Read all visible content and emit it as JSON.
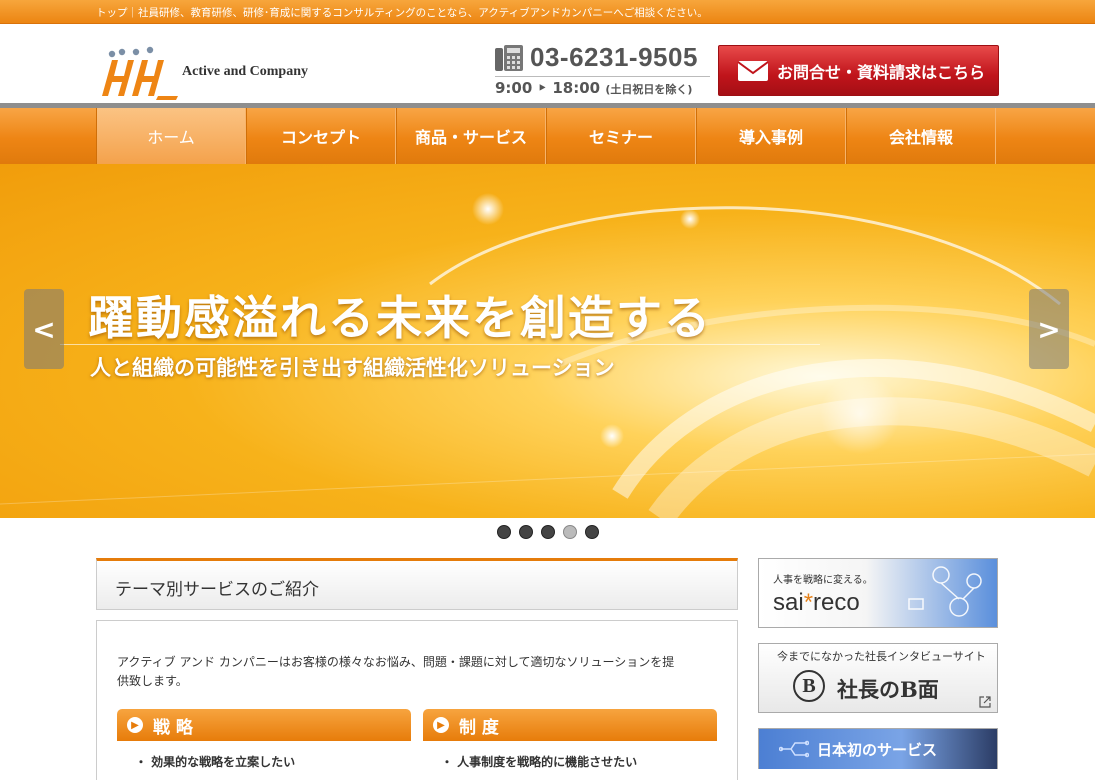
{
  "topbar": {
    "text": "トップ｜社員研修、教育研修、研修･育成に関するコンサルティングのことなら、アクティブアンドカンパニーへご相談ください。"
  },
  "header": {
    "logo_text": "Active and Company",
    "phone": "03-6231-9505",
    "hours": "9:00 ‣ 18:00",
    "hours_note": "(土日祝日を除く)",
    "cta_label": "お問合せ・資料請求はこちら"
  },
  "nav": {
    "items": [
      {
        "label": "ホーム"
      },
      {
        "label": "コンセプト"
      },
      {
        "label": "商品・サービス"
      },
      {
        "label": "セミナー"
      },
      {
        "label": "導入事例"
      },
      {
        "label": "会社情報"
      }
    ]
  },
  "hero": {
    "title": "躍動感溢れる未来を創造する",
    "subtitle": "人と組織の可能性を引き出す組織活性化ソリューション",
    "prev": "<",
    "next": ">",
    "slide_count": 5,
    "active_slide": 4
  },
  "section": {
    "title": "テーマ別サービスのご紹介",
    "intro": "アクティブ アンド カンパニーはお客様の様々なお悩み、問題・課題に対して適切なソリューションを提供致します。",
    "themes": [
      {
        "title": "戦 略",
        "item": "・ 効果的な戦略を立案したい"
      },
      {
        "title": "制 度",
        "item": "・ 人事制度を戦略的に機能させたい"
      }
    ]
  },
  "sidebar": {
    "banner1": {
      "tagline": "人事を戦略に変える。",
      "brand_a": "sai",
      "brand_star": "*",
      "brand_b": "reco"
    },
    "banner2": {
      "tagline": "今までになかった社長インタビューサイト",
      "badge": "B",
      "title": "社長のB面"
    },
    "banner3": {
      "title": "日本初のサービス"
    }
  },
  "colors": {
    "accent": "#ec8512",
    "cta": "#c0141b"
  }
}
